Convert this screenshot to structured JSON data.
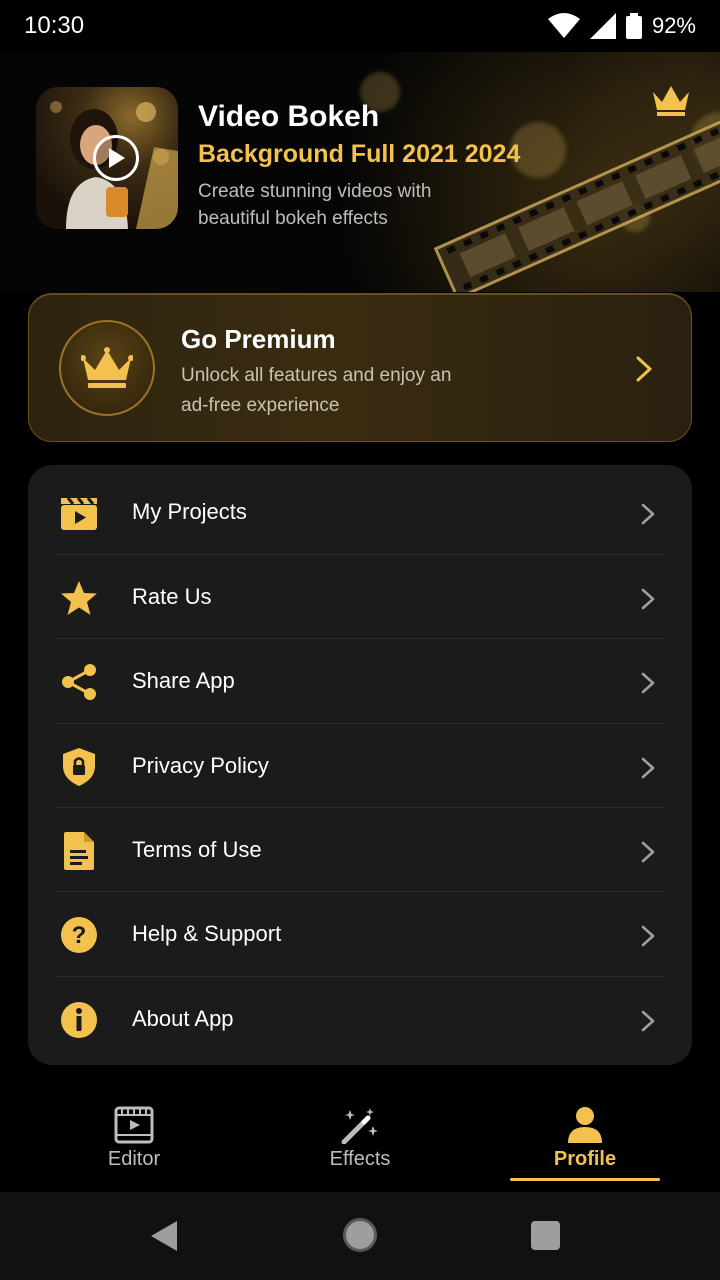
{
  "status_bar": {
    "time": "10:30",
    "battery": "92%"
  },
  "header": {
    "title": "Video Bokeh",
    "subtitle": "Background Full 2021 2024",
    "description": "Create stunning videos with beautiful bokeh effects"
  },
  "premium": {
    "title": "Go Premium",
    "description": "Unlock all features and enjoy an ad-free experience"
  },
  "menu": {
    "items": [
      {
        "label": "My Projects",
        "icon": "clapperboard-icon"
      },
      {
        "label": "Rate Us",
        "icon": "star-icon"
      },
      {
        "label": "Share App",
        "icon": "share-icon"
      },
      {
        "label": "Privacy Policy",
        "icon": "shield-lock-icon"
      },
      {
        "label": "Terms of Use",
        "icon": "document-icon"
      },
      {
        "label": "Help & Support",
        "icon": "help-circle-icon"
      },
      {
        "label": "About App",
        "icon": "info-circle-icon"
      }
    ]
  },
  "bottom_nav": {
    "tabs": [
      {
        "label": "Editor",
        "icon": "film-icon",
        "active": false
      },
      {
        "label": "Effects",
        "icon": "magic-wand-icon",
        "active": false
      },
      {
        "label": "Profile",
        "icon": "person-icon",
        "active": true
      }
    ]
  },
  "colors": {
    "accent": "#f2c14e",
    "background": "#000000",
    "card": "#1b1b1b",
    "inactive": "#bdbdbd"
  }
}
